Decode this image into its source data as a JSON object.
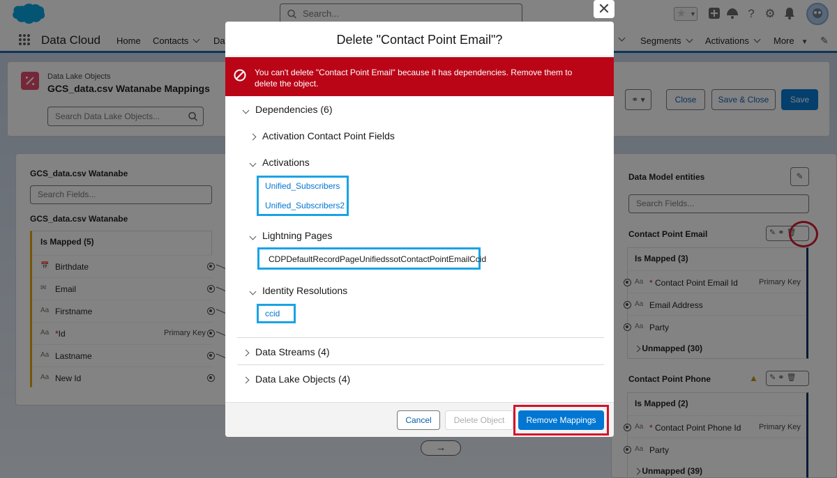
{
  "header": {
    "search_placeholder": "Search...",
    "app_name": "Data Cloud",
    "nav": [
      "Home",
      "Contacts",
      "Dat",
      "Segments",
      "Activations",
      "More"
    ]
  },
  "object_header": {
    "breadcrumb": "Data Lake Objects",
    "title": "GCS_data.csv Watanabe Mappings",
    "search_placeholder": "Search Data Lake Objects...",
    "close_label": "Close",
    "save_close_label": "Save & Close",
    "save_label": "Save"
  },
  "left_panel": {
    "title": "GCS_data.csv Watanabe",
    "search_placeholder": "Search Fields...",
    "subtitle": "GCS_data.csv Watanabe",
    "group_label": "Is Mapped (5)",
    "fields": [
      {
        "name": "Birthdate",
        "tag": ""
      },
      {
        "name": "Email",
        "tag": ""
      },
      {
        "name": "Firstname",
        "tag": ""
      },
      {
        "name": "Id",
        "tag": "Primary Key",
        "required": "*"
      },
      {
        "name": "Lastname",
        "tag": ""
      },
      {
        "name": "New Id",
        "tag": ""
      }
    ]
  },
  "right_panel": {
    "title": "Data Model entities",
    "search_placeholder": "Search Fields...",
    "entities": [
      {
        "name": "Contact Point Email",
        "mapped_label": "Is Mapped (3)",
        "fields": [
          {
            "name": "Contact Point Email Id",
            "tag": "Primary Key",
            "required": "*"
          },
          {
            "name": "Email Address",
            "tag": ""
          },
          {
            "name": "Party",
            "tag": ""
          }
        ],
        "unmapped_label": "Unmapped (30)"
      },
      {
        "name": "Contact Point Phone",
        "mapped_label": "Is Mapped (2)",
        "fields": [
          {
            "name": "Contact Point Phone Id",
            "tag": "Primary Key",
            "required": "*"
          },
          {
            "name": "Party",
            "tag": ""
          }
        ],
        "unmapped_label": "Unmapped (39)"
      }
    ]
  },
  "modal": {
    "title": "Delete \"Contact Point Email\"?",
    "error": "You can't delete \"Contact Point Email\" because it has dependencies. Remove them to delete the object.",
    "dependencies_label": "Dependencies (6)",
    "sections": {
      "activation_fields": "Activation Contact Point Fields",
      "activations": "Activations",
      "activation_items": [
        "Unified_Subscribers",
        "Unified_Subscribers2"
      ],
      "lightning_pages": "Lightning Pages",
      "lightning_item": "CDPDefaultRecordPageUnifiedssotContactPointEmailCcid",
      "identity_resolutions": "Identity Resolutions",
      "identity_item": "ccid",
      "data_streams": "Data Streams (4)",
      "data_lake_objects": "Data Lake Objects (4)"
    },
    "cancel_label": "Cancel",
    "delete_label": "Delete Object",
    "remove_label": "Remove Mappings"
  }
}
